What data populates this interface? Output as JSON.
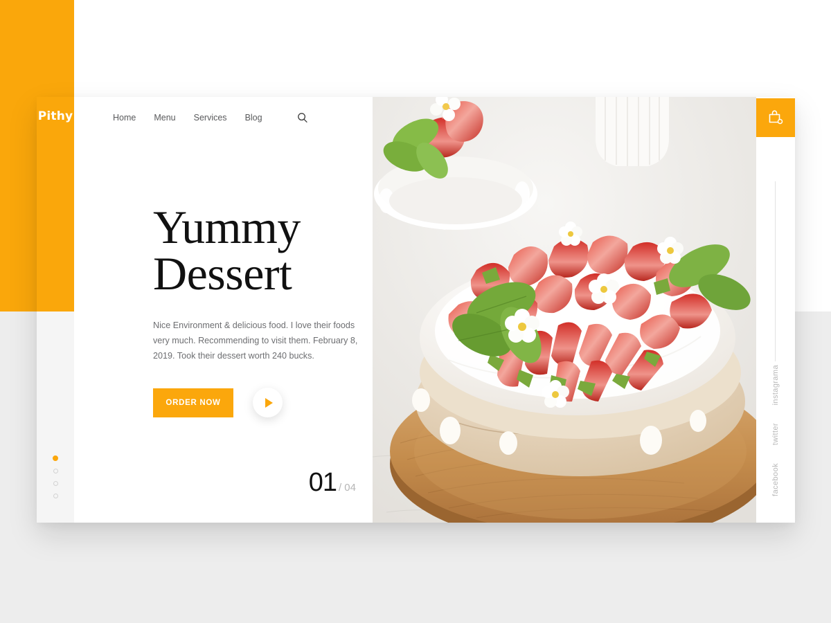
{
  "brand": {
    "logo": "Pithy"
  },
  "nav": {
    "items": [
      {
        "label": "Home"
      },
      {
        "label": "Menu"
      },
      {
        "label": "Services"
      },
      {
        "label": "Blog"
      }
    ],
    "search_icon": "search-icon"
  },
  "hero": {
    "headline": "Yummy\nDessert",
    "description": "Nice Environment & delicious food. I love their foods very much. Recommending to visit them. February 8, 2019. Took their dessert worth 240 bucks.",
    "order_label": "ORDER NOW",
    "play_icon": "play-icon"
  },
  "slider": {
    "current": "01",
    "total": "/ 04",
    "dots": [
      {
        "active": true
      },
      {
        "active": false
      },
      {
        "active": false
      },
      {
        "active": false
      }
    ]
  },
  "cart": {
    "icon": "shopping-bag-icon"
  },
  "socials": [
    {
      "label": "facebook"
    },
    {
      "label": "twitter"
    },
    {
      "label": "instagrama"
    }
  ],
  "photo": {
    "alt": "strawberry-pavlova-on-wooden-board",
    "colors": {
      "surface": "#eceae6",
      "board": "#c08a4a",
      "board_light": "#d6a66a",
      "meringue": "#e9dcc7",
      "cream": "#fdfcfa",
      "strawberry": "#d8352c",
      "strawberry_light": "#f08b85",
      "leaf": "#6fa83c"
    }
  },
  "theme": {
    "accent": "#fba70c",
    "page_bg": "#ededed",
    "card_bg": "#ffffff",
    "rail_bg": "#f5f5f5",
    "text_dark": "#111111",
    "text_muted": "#6d6e71"
  }
}
